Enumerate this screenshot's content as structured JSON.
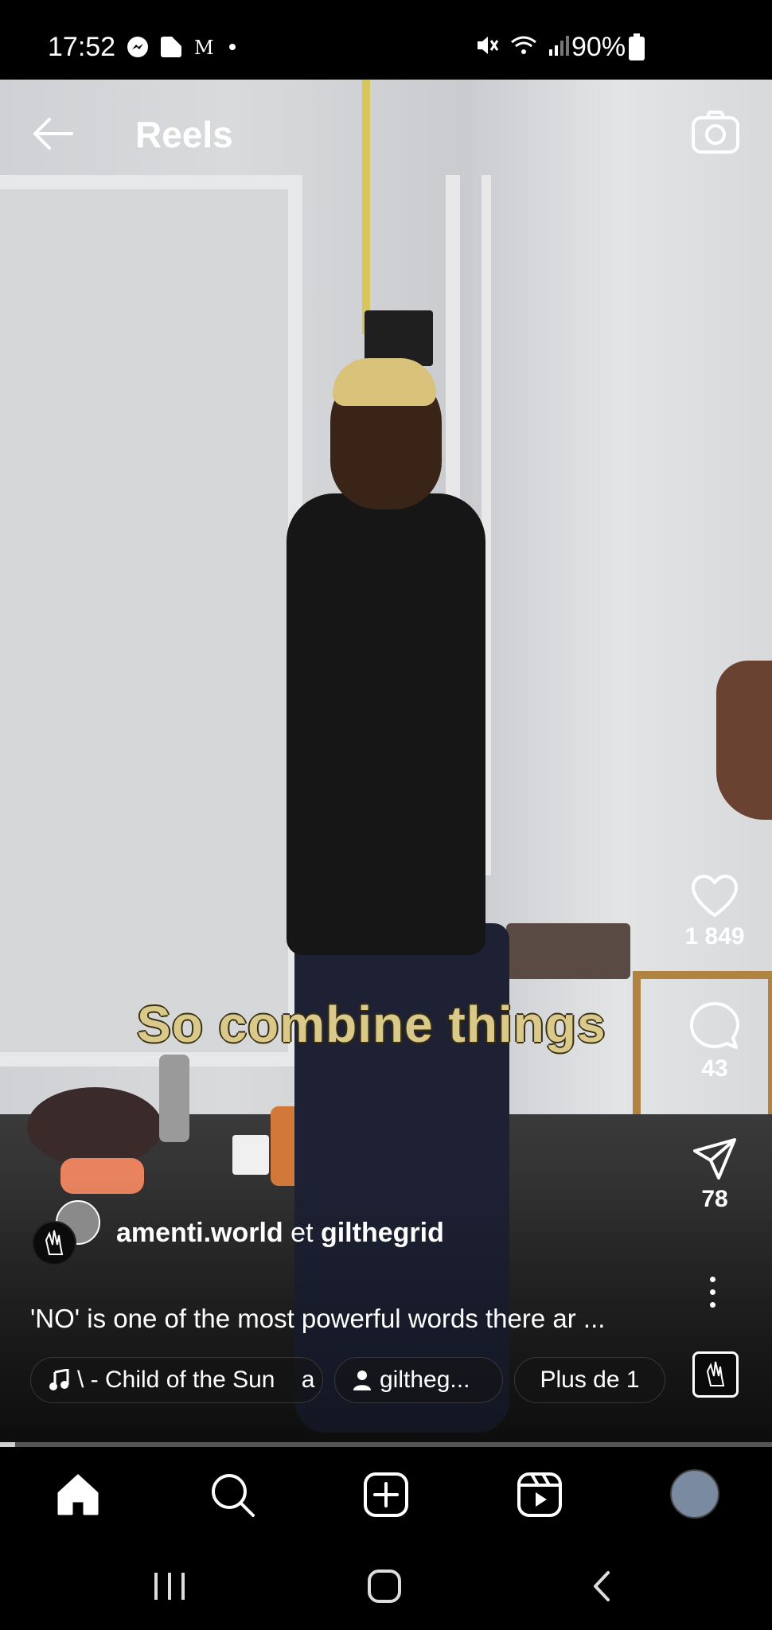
{
  "status_bar": {
    "time": "17:52",
    "battery_percent": "90%",
    "icons_left": [
      "messenger-icon",
      "flipboard-icon",
      "news-icon",
      "dot-icon"
    ],
    "icons_right": [
      "mute-icon",
      "wifi-icon",
      "signal-icon",
      "battery-icon"
    ]
  },
  "header": {
    "title": "Reels"
  },
  "video": {
    "caption_overlay": "So combine things",
    "progress": 0.02
  },
  "actions": {
    "like_count": "1 849",
    "comment_count": "43",
    "share_count": "78"
  },
  "post": {
    "author_primary": "amenti.world",
    "connector": "et",
    "author_secondary": "gilthegrid",
    "description": "'NO' is one of the most powerful words there ar ..."
  },
  "pills": {
    "music_label": "\\ - Child of the Sun    a",
    "user_label": "giltheg...",
    "more_label": "Plus de 1"
  },
  "nav": {
    "items": [
      "home-icon",
      "search-icon",
      "create-icon",
      "reels-icon",
      "profile-avatar"
    ]
  },
  "system_nav": {
    "items": [
      "recent-apps-icon",
      "home-circle-icon",
      "back-chevron-icon"
    ]
  }
}
